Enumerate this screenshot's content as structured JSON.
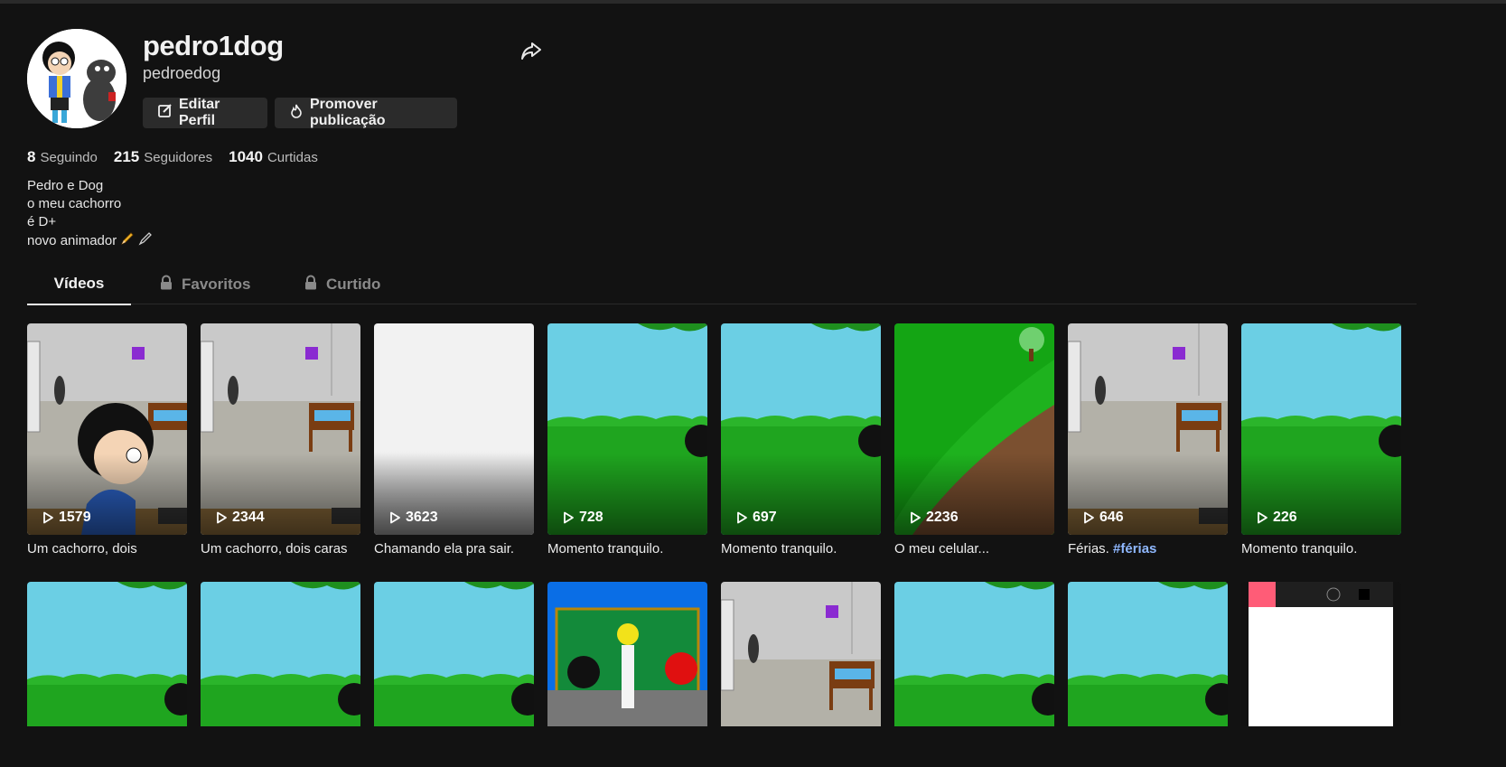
{
  "profile": {
    "username": "pedro1dog",
    "nickname": "pedroedog",
    "edit_label": "Editar Perfil",
    "promote_label": "Promover publicação",
    "stats": {
      "following_count": "8",
      "following_label": "Seguindo",
      "followers_count": "215",
      "followers_label": "Seguidores",
      "likes_count": "1040",
      "likes_label": "Curtidas"
    },
    "bio": [
      "Pedro e Dog",
      "o meu cachorro",
      "é D+",
      "novo animador"
    ]
  },
  "tabs": [
    "Vídeos",
    "Favoritos",
    "Curtido"
  ],
  "videos": [
    {
      "views": "1579",
      "caption": "Um cachorro, dois",
      "scene": "bedroom-kid"
    },
    {
      "views": "2344",
      "caption": "Um cachorro, dois caras",
      "scene": "bedroom"
    },
    {
      "views": "3623",
      "caption": "Chamando ela pra sair.",
      "scene": "blank"
    },
    {
      "views": "728",
      "caption": "Momento tranquilo.",
      "scene": "park"
    },
    {
      "views": "697",
      "caption": "Momento tranquilo.",
      "scene": "park"
    },
    {
      "views": "2236",
      "caption": "O meu celular...",
      "scene": "hill"
    },
    {
      "views": "646",
      "caption": "Férias.",
      "hashtag": "#férias",
      "scene": "bedroom"
    },
    {
      "views": "226",
      "caption": "Momento tranquilo.",
      "scene": "park"
    }
  ],
  "videos_row2": [
    {
      "scene": "park"
    },
    {
      "scene": "park"
    },
    {
      "scene": "park"
    },
    {
      "scene": "classroom"
    },
    {
      "scene": "bedroom"
    },
    {
      "scene": "park"
    },
    {
      "scene": "park"
    },
    {
      "scene": "drawing-app"
    }
  ],
  "colors": {
    "background": "#121212",
    "button": "#2b2b2b",
    "hashtag": "#8fb8ff",
    "sky": "#6bcfe4",
    "grass": "#1fa51f"
  }
}
